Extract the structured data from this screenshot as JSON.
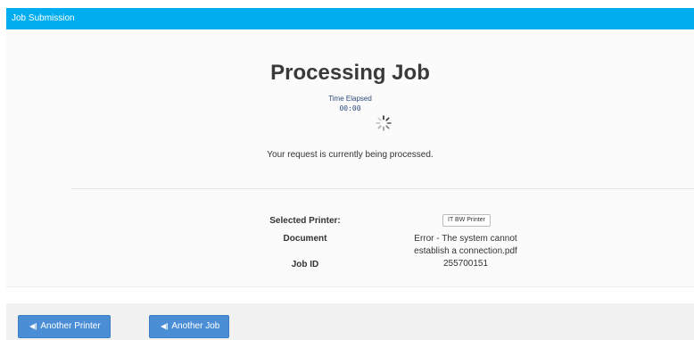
{
  "header": {
    "title": "Job Submission"
  },
  "main": {
    "heading": "Processing Job",
    "elapsed_label": "Time Elapsed",
    "elapsed_value": "00:00",
    "status_message": "Your request is currently being processed."
  },
  "details": {
    "printer_label": "Selected Printer:",
    "printer_value": "IT BW Printer",
    "document_label": "Document",
    "document_value_line1": "Error - The system cannot",
    "document_value_line2": "establish a connection.pdf",
    "jobid_label": "Job ID",
    "jobid_value": "255700151"
  },
  "footer": {
    "another_printer_icon": "skip-back-icon",
    "another_printer_label": "Another Printer",
    "another_job_icon": "skip-back-icon",
    "another_job_label": "Another Job"
  },
  "colors": {
    "header_bg": "#00adef",
    "button_bg": "#4a8fd6",
    "elapsed_text": "#2c4a7a"
  }
}
